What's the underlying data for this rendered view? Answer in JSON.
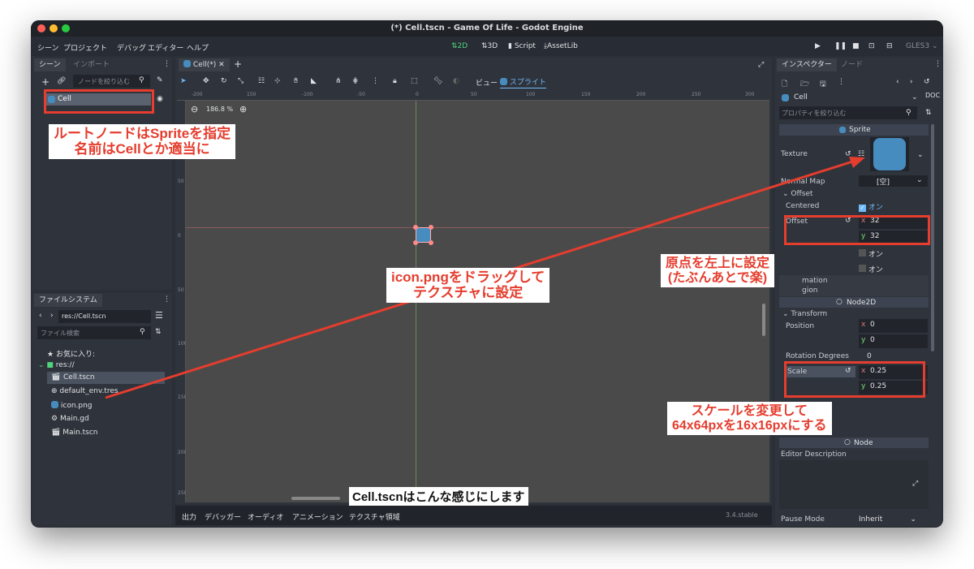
{
  "window": {
    "title": "(*) Cell.tscn - Game Of Life - Godot Engine"
  },
  "menu": {
    "items": [
      "シーン",
      "プロジェクト",
      "デバッグ",
      "エディター",
      "ヘルプ"
    ]
  },
  "workspace": {
    "mode_2d": "2D",
    "mode_3d": "3D",
    "script": "Script",
    "assetlib": "AssetLib"
  },
  "renderer": "GLES3",
  "scene_dock": {
    "tab_scene": "シーン",
    "tab_import": "インポート",
    "filter_placeholder": "ノードを絞り込む",
    "node_name": "Cell"
  },
  "filesystem": {
    "title": "ファイルシステム",
    "path": "res://Cell.tscn",
    "search_placeholder": "ファイル検索",
    "favorites": "お気に入り:",
    "root": "res://",
    "files": [
      "Cell.tscn",
      "default_env.tres",
      "icon.png",
      "Main.gd",
      "Main.tscn"
    ]
  },
  "editor": {
    "tab": "Cell(*)",
    "zoom": "186.8 %",
    "view_menu": "ビュー",
    "sprite_menu": "スプライト",
    "ruler_marks": [
      "-200",
      "150",
      "-100",
      "-50",
      "0",
      "50",
      "100",
      "150",
      "200",
      "250",
      "300"
    ],
    "ruler_v_marks": [
      "100",
      "50",
      "0",
      "50",
      "100",
      "150",
      "200",
      "250"
    ]
  },
  "bottom_bar": {
    "tabs": [
      "出力",
      "デバッガー",
      "オーディオ",
      "アニメーション",
      "テクスチャ領域"
    ],
    "version": "3.4.stable"
  },
  "inspector": {
    "tab_inspector": "インスペクター",
    "tab_node": "ノード",
    "object": "Cell",
    "filter_placeholder": "プロパティを絞り込む",
    "section_sprite": "Sprite",
    "texture_label": "Texture",
    "normal_map_label": "Normal Map",
    "normal_map_value": "[空]",
    "offset_group": "Offset",
    "centered_label": "Centered",
    "centered_value": "オン",
    "offset_label": "Offset",
    "offset_x": "32",
    "offset_y": "32",
    "flip_h_value": "オン",
    "flip_v_value": "オン",
    "animation_partial": "mation",
    "region_partial": "gion",
    "section_node2d": "Node2D",
    "transform_group": "Transform",
    "position_label": "Position",
    "position_x": "0",
    "position_y": "0",
    "rotation_label": "Rotation Degrees",
    "rotation_value": "0",
    "scale_label": "Scale",
    "scale_x": "0.25",
    "scale_y": "0.25",
    "node_partial": "Node",
    "editor_description": "Editor Description",
    "pause_mode_label": "Pause Mode",
    "pause_mode_value": "Inherit",
    "axis_x": "x",
    "axis_y": "y"
  },
  "annotations": {
    "root_node_line1": "ルートノードはSpriteを指定",
    "root_node_line2": "名前はCellとか適当に",
    "drag_line1": "icon.pngをドラッグして",
    "drag_line2": "テクスチャに設定",
    "origin_line1": "原点を左上に設定",
    "origin_line2": "(たぶんあとで楽)",
    "scale_line1": "スケールを変更して",
    "scale_line2": "64x64pxを16x16pxにする",
    "caption": "Cell.tscnはこんな感じにします"
  },
  "colors": {
    "annotation_red": "#e53d2e",
    "godot_blue": "#478cbf",
    "accent_green": "#2ecc71",
    "accent_blue": "#70bafa"
  }
}
